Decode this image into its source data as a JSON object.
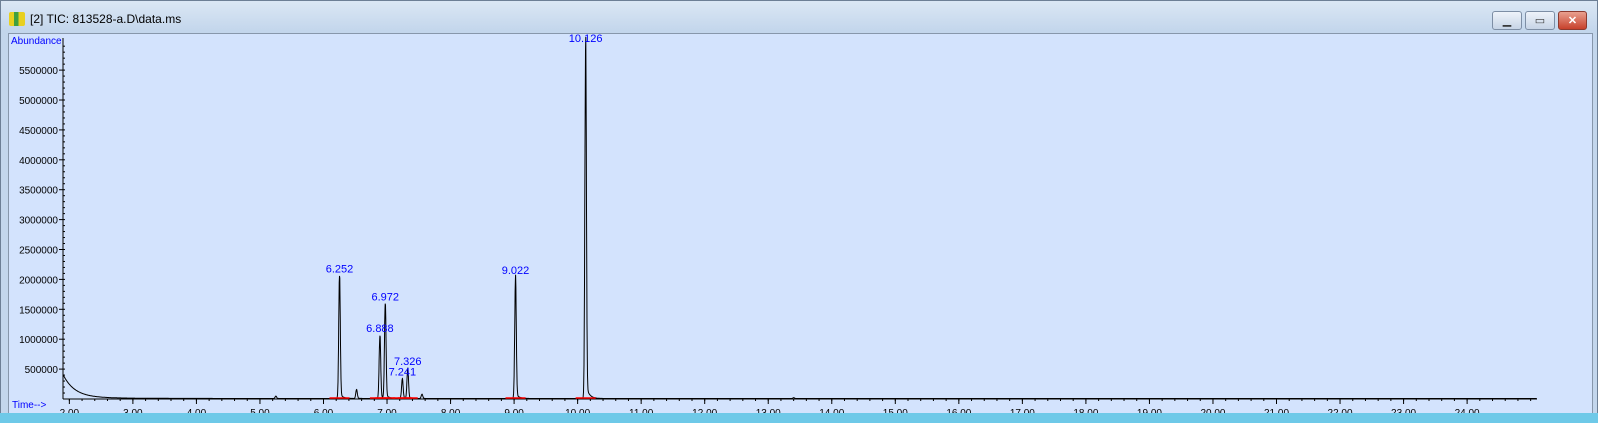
{
  "window": {
    "title": "[2] TIC: 813528-a.D\\data.ms",
    "icon": "chromatogram-icon",
    "buttons": {
      "minimize": "minimize-icon",
      "maximize": "maximize-icon",
      "close": "close-icon"
    }
  },
  "chart_data": {
    "type": "line",
    "title": "",
    "ylabel": "Abundance",
    "xlabel": "Time-->",
    "xlim": [
      1.9,
      25.1
    ],
    "ylim": [
      0,
      6000000
    ],
    "x_ticks": [
      "2.00",
      "3.00",
      "4.00",
      "5.00",
      "6.00",
      "7.00",
      "8.00",
      "9.00",
      "10.00",
      "11.00",
      "12.00",
      "13.00",
      "14.00",
      "15.00",
      "16.00",
      "17.00",
      "18.00",
      "19.00",
      "20.00",
      "21.00",
      "22.00",
      "23.00",
      "24.00"
    ],
    "y_ticks": [
      "500000",
      "1000000",
      "1500000",
      "2000000",
      "2500000",
      "3000000",
      "3500000",
      "4000000",
      "4500000",
      "5000000",
      "5500000"
    ],
    "grid": false,
    "peaks": [
      {
        "label": "6.252",
        "rt": 6.252,
        "abundance": 2050000
      },
      {
        "label": "6.888",
        "rt": 6.888,
        "abundance": 1050000
      },
      {
        "label": "6.972",
        "rt": 6.972,
        "abundance": 1580000
      },
      {
        "label": "7.241",
        "rt": 7.241,
        "abundance": 330000
      },
      {
        "label": "7.326",
        "rt": 7.326,
        "abundance": 500000
      },
      {
        "label": "9.022",
        "rt": 9.022,
        "abundance": 2020000
      },
      {
        "label": "10.126",
        "rt": 10.126,
        "abundance": 5900000
      }
    ],
    "minor_peaks": [
      {
        "rt": 5.25,
        "abundance": 40000
      },
      {
        "rt": 6.52,
        "abundance": 150000
      },
      {
        "rt": 7.55,
        "abundance": 70000
      },
      {
        "rt": 13.4,
        "abundance": 15000
      }
    ],
    "initial_signal": 380000,
    "colors": {
      "trace": "#000000",
      "labels": "#0000ff",
      "baseline_marks": "#ff0000",
      "background": "#d3e3fd"
    }
  }
}
